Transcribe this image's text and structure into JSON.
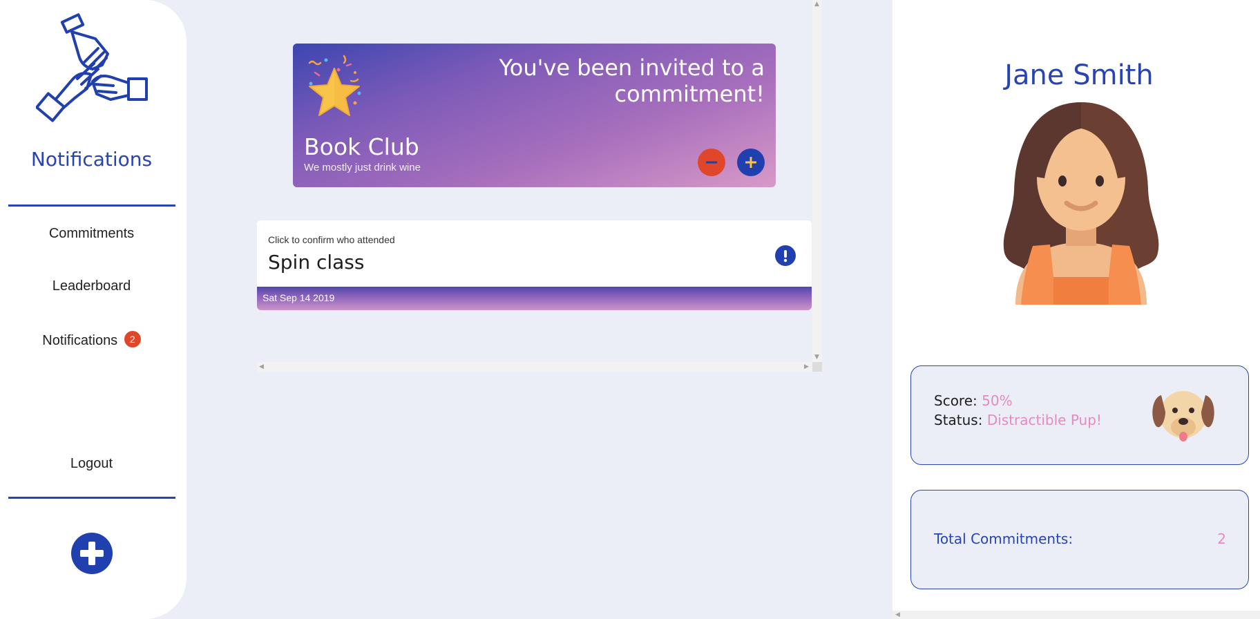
{
  "sidebar": {
    "title": "Notifications",
    "items": [
      {
        "label": "Commitments"
      },
      {
        "label": "Leaderboard"
      },
      {
        "label": "Notifications",
        "badge": "2"
      }
    ],
    "logout_label": "Logout",
    "logo_icon": "hands-stack-logo-icon",
    "add_icon": "plus-circle-icon"
  },
  "invite": {
    "heading": "You've been invited to a commitment!",
    "name": "Book Club",
    "description": "We mostly just drink wine",
    "decline_icon": "minus-icon",
    "accept_icon": "plus-icon"
  },
  "event": {
    "hint": "Click to confirm who attended",
    "title": "Spin class",
    "date": "Sat Sep 14 2019",
    "alert_icon": "exclamation-icon"
  },
  "profile": {
    "name": "Jane Smith",
    "score_label": "Score:",
    "score_value": "50%",
    "status_label": "Status:",
    "status_value": "Distractible Pup!",
    "total_label": "Total Commitments:",
    "total_value": "2"
  },
  "colors": {
    "brand_blue": "#2844b3",
    "danger": "#e0462a",
    "accent_pink": "#e58bbf",
    "background": "#eceef7"
  }
}
